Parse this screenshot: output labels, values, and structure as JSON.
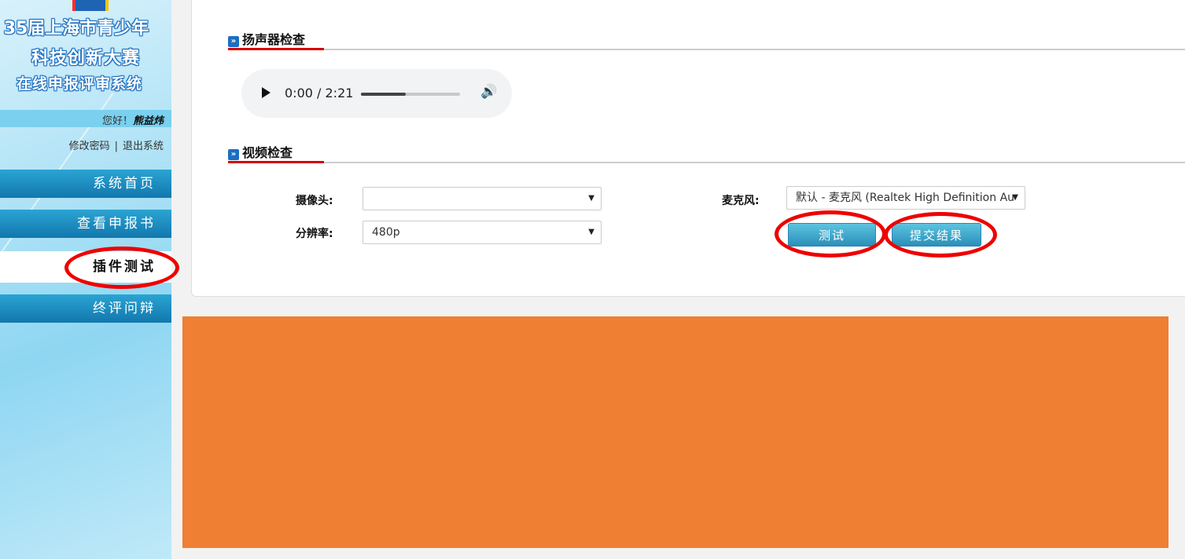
{
  "sidebar": {
    "logo_lines": [
      "35届上海市青少年",
      "科技创新大赛",
      "在线申报评审系统"
    ],
    "greeting": "您好！",
    "username": "熊益炜",
    "change_password": "修改密码",
    "separator": "|",
    "logout": "退出系统",
    "nav": [
      {
        "label": "系统首页",
        "active": false
      },
      {
        "label": "查看申报书",
        "active": false
      },
      {
        "label": "插件测试",
        "active": true
      },
      {
        "label": "终评问辩",
        "active": false
      }
    ]
  },
  "speaker_section": {
    "title": "扬声器检查",
    "player": {
      "current_time": "0:00",
      "duration": "2:21",
      "time_display": "0:00 / 2:21",
      "progress_fraction": 0.45
    }
  },
  "video_section": {
    "title": "视频检查",
    "camera_label": "摄像头:",
    "camera_value": "",
    "resolution_label": "分辨率:",
    "resolution_value": "480p",
    "mic_label": "麦克风:",
    "mic_value": "默认 - 麦克风 (Realtek High Definition Au",
    "test_button": "测试",
    "submit_button": "提交结果"
  },
  "colors": {
    "accent_red": "#d40000",
    "nav_blue": "#1277ad",
    "annotation_red": "#ee0000",
    "redaction_orange": "#ee7f33"
  }
}
